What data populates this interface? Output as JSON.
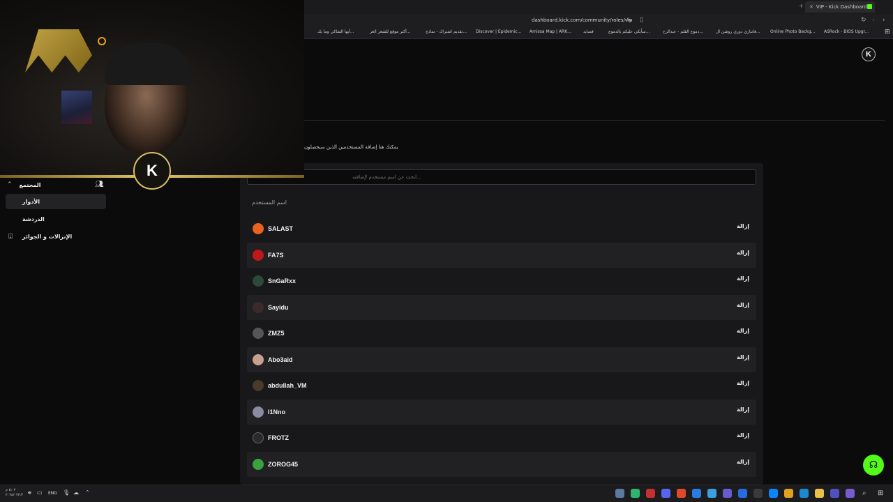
{
  "browser": {
    "tab_title": "VIP - Kick Dashboard",
    "url": "dashboard.kick.com/community/roles/vip",
    "bookmarks": [
      "ASRock - BIOS Upgr...",
      "Online Photo Backg...",
      "فانتازي دوري روشن ال...",
      "دموع القلم - عبدالرح...",
      "سأبكي عليكم بالدموع...",
      "قصايد",
      "Amissa Map | ARK...",
      "Discover | Epidemic...",
      "تقديم اشتراك - تماذج...",
      "أكبر موقع للشعر العر...",
      "أيها الشاكي وما بك..."
    ]
  },
  "page": {
    "description": "يمكنك هنا إضافة المستخدمين الذين سيحصلون",
    "search_placeholder": "ابحث عن اسم مستخدم لإضافته...",
    "column_header": "اسم المستخدم",
    "remove_label": "إزالة"
  },
  "sidebar": {
    "section_label": "المجتمع",
    "items": [
      {
        "label": "الأدوار",
        "active": true
      },
      {
        "label": "الدردشة",
        "active": false
      },
      {
        "label": "الإنزالات و الجوائز",
        "active": false
      }
    ]
  },
  "vip_users": [
    {
      "name": "SALAST",
      "avatar_color": "#e8641e"
    },
    {
      "name": "FA7S",
      "avatar_color": "#c01818"
    },
    {
      "name": "SnGaRxx",
      "avatar_color": "#2b4a3a"
    },
    {
      "name": "Sayidu",
      "avatar_color": "#3a2a2a"
    },
    {
      "name": "ZMZ5",
      "avatar_color": "#555555"
    },
    {
      "name": "Abo3aid",
      "avatar_color": "#c8a090"
    },
    {
      "name": "abdullah_VM",
      "avatar_color": "#4a3a2a"
    },
    {
      "name": "l1Nno",
      "avatar_color": "#8a8aa0"
    },
    {
      "name": "FROTZ",
      "avatar_color": "#2a2a2a"
    },
    {
      "name": "ZOROG45",
      "avatar_color": "#3aa040"
    }
  ],
  "taskbar": {
    "language": "ENG",
    "time": "٥:٠٢ م",
    "date": "٢٠٢٤/٠٢/١٣"
  },
  "colors": {
    "accent": "#53fc18",
    "background": "#0b0b0c",
    "panel": "#18181a",
    "row_alt": "#212124"
  }
}
